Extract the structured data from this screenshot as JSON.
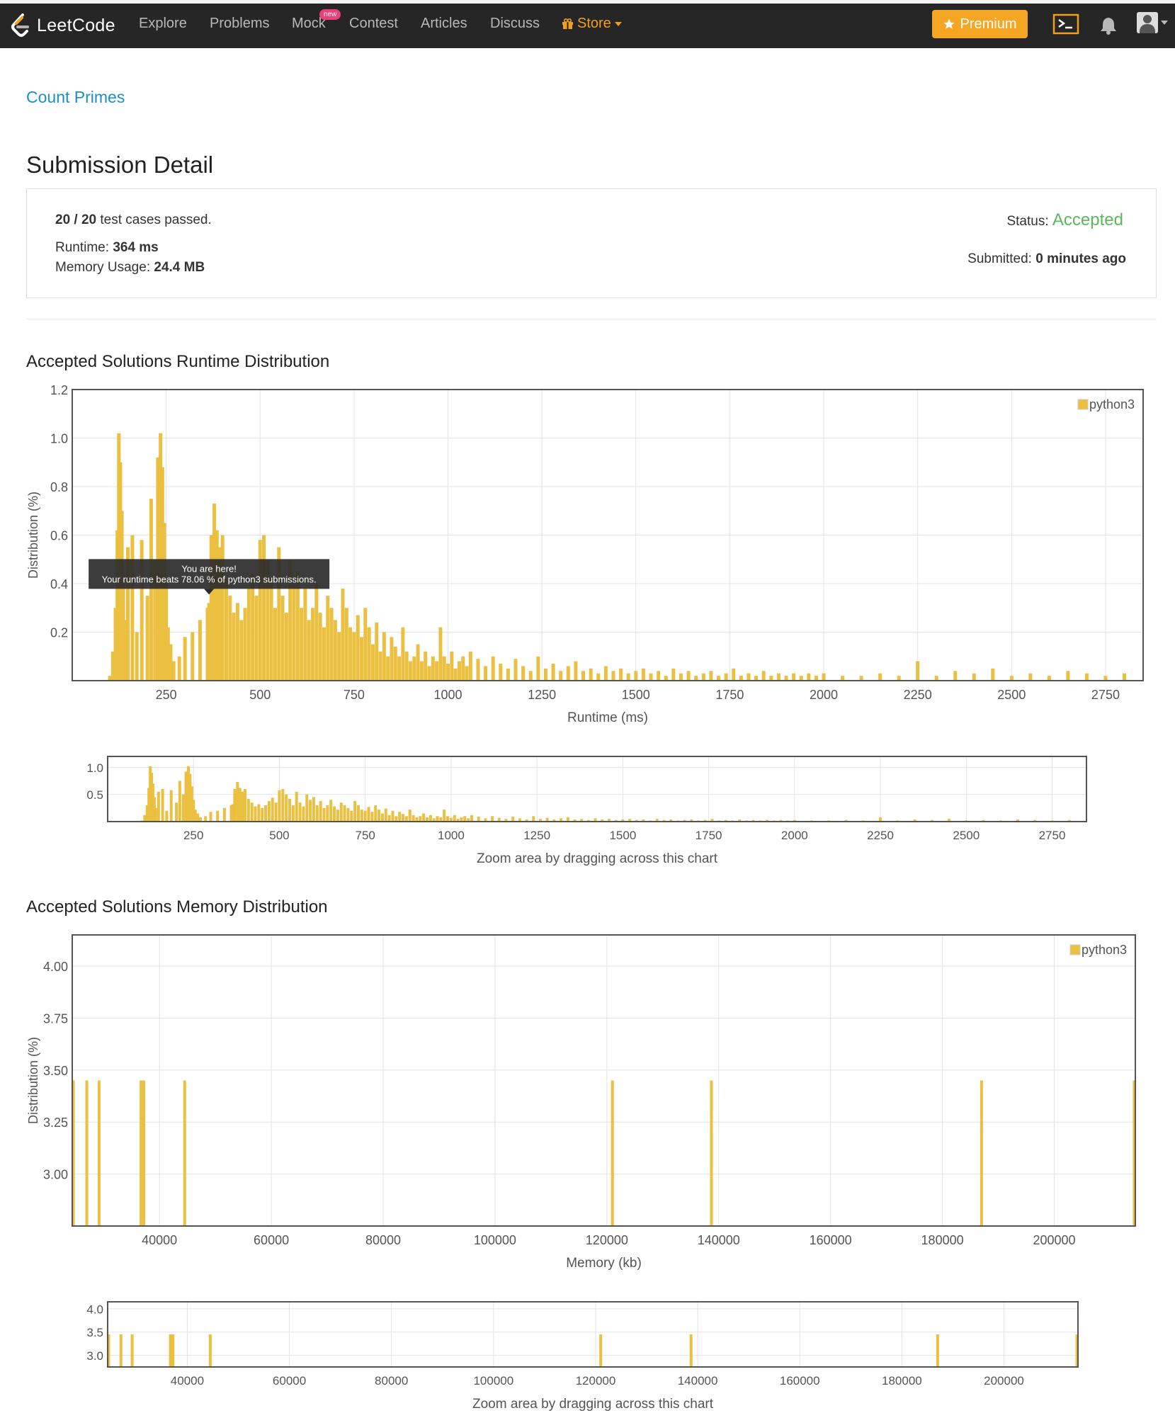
{
  "nav": {
    "brand": "LeetCode",
    "links": [
      "Explore",
      "Problems",
      "Mock",
      "Contest",
      "Articles",
      "Discuss"
    ],
    "new_badge": "new",
    "store": "Store",
    "premium": "Premium"
  },
  "problem": {
    "title": "Count Primes"
  },
  "page_title": "Submission Detail",
  "detail": {
    "passed": "20",
    "total": "20",
    "passed_suffix": "test cases passed.",
    "runtime_label": "Runtime:",
    "runtime_value": "364 ms",
    "memory_label": "Memory Usage:",
    "memory_value": "24.4 MB",
    "status_label": "Status:",
    "status_value": "Accepted",
    "submitted_label": "Submitted:",
    "submitted_value": "0 minutes ago"
  },
  "colors": {
    "accent": "#ebbf3f",
    "status_ok": "#5cb85c",
    "link": "#1a90c6",
    "premium": "#f5a623"
  },
  "tooltip": {
    "line1": "You are here!",
    "line2": "Your runtime beats 78.06 % of python3 submissions."
  },
  "sections": {
    "runtime_title": "Accepted Solutions Runtime Distribution",
    "memory_title": "Accepted Solutions Memory Distribution",
    "zoom_caption": "Zoom area by dragging across this chart"
  },
  "chart_data": [
    {
      "type": "bar",
      "title": "Accepted Solutions Runtime Distribution",
      "xlabel": "Runtime (ms)",
      "ylabel": "Distribution (%)",
      "xlim": [
        0,
        2850
      ],
      "ylim": [
        0,
        1.2
      ],
      "xticks": [
        "250",
        "500",
        "750",
        "1000",
        "1250",
        "1500",
        "1750",
        "2000",
        "2250",
        "2500",
        "2750"
      ],
      "yticks": [
        "0.2",
        "0.4",
        "0.6",
        "0.8",
        "1.0",
        "1.2"
      ],
      "legend": "top-right",
      "grid": true,
      "series": [
        {
          "name": "python3",
          "x": [
            100,
            108,
            115,
            120,
            124,
            128,
            132,
            136,
            140,
            148,
            160,
            172,
            185,
            200,
            210,
            220,
            228,
            235,
            240,
            245,
            250,
            255,
            262,
            270,
            285,
            300,
            320,
            340,
            360,
            364,
            370,
            378,
            385,
            392,
            400,
            410,
            420,
            430,
            440,
            450,
            460,
            470,
            480,
            490,
            500,
            510,
            520,
            530,
            540,
            550,
            560,
            570,
            580,
            590,
            600,
            610,
            620,
            630,
            640,
            650,
            660,
            670,
            680,
            690,
            700,
            710,
            720,
            730,
            740,
            750,
            760,
            770,
            780,
            790,
            800,
            810,
            820,
            830,
            840,
            850,
            860,
            870,
            880,
            890,
            900,
            910,
            920,
            930,
            940,
            950,
            960,
            970,
            980,
            990,
            1000,
            1010,
            1020,
            1030,
            1040,
            1050,
            1060,
            1080,
            1100,
            1120,
            1140,
            1160,
            1180,
            1200,
            1220,
            1240,
            1260,
            1280,
            1300,
            1320,
            1340,
            1360,
            1380,
            1400,
            1420,
            1440,
            1460,
            1480,
            1500,
            1520,
            1540,
            1560,
            1580,
            1600,
            1620,
            1640,
            1660,
            1680,
            1700,
            1720,
            1740,
            1760,
            1780,
            1800,
            1820,
            1840,
            1860,
            1880,
            1900,
            1920,
            1940,
            1960,
            1980,
            2000,
            2050,
            2100,
            2150,
            2200,
            2250,
            2300,
            2350,
            2400,
            2450,
            2500,
            2550,
            2600,
            2650,
            2700,
            2750,
            2800
          ],
          "values": [
            0.02,
            0.12,
            0.3,
            0.62,
            1.02,
            0.9,
            0.7,
            0.45,
            0.25,
            0.55,
            0.6,
            0.2,
            0.58,
            0.35,
            0.75,
            0.5,
            0.92,
            1.02,
            0.88,
            0.65,
            0.4,
            0.22,
            0.15,
            0.08,
            0.1,
            0.18,
            0.2,
            0.25,
            0.3,
            0.32,
            0.6,
            0.73,
            0.62,
            0.55,
            0.6,
            0.42,
            0.35,
            0.28,
            0.32,
            0.25,
            0.3,
            0.38,
            0.44,
            0.35,
            0.58,
            0.6,
            0.5,
            0.42,
            0.3,
            0.55,
            0.35,
            0.28,
            0.5,
            0.4,
            0.45,
            0.3,
            0.38,
            0.25,
            0.3,
            0.4,
            0.28,
            0.22,
            0.35,
            0.3,
            0.25,
            0.2,
            0.38,
            0.3,
            0.22,
            0.2,
            0.27,
            0.18,
            0.3,
            0.22,
            0.15,
            0.24,
            0.12,
            0.2,
            0.1,
            0.18,
            0.14,
            0.1,
            0.22,
            0.12,
            0.08,
            0.1,
            0.15,
            0.08,
            0.12,
            0.06,
            0.1,
            0.08,
            0.22,
            0.1,
            0.07,
            0.12,
            0.05,
            0.08,
            0.1,
            0.06,
            0.12,
            0.09,
            0.06,
            0.1,
            0.07,
            0.05,
            0.09,
            0.06,
            0.04,
            0.1,
            0.05,
            0.07,
            0.04,
            0.06,
            0.08,
            0.04,
            0.05,
            0.03,
            0.06,
            0.04,
            0.05,
            0.03,
            0.04,
            0.05,
            0.03,
            0.04,
            0.02,
            0.05,
            0.03,
            0.04,
            0.02,
            0.03,
            0.04,
            0.02,
            0.03,
            0.05,
            0.02,
            0.03,
            0.02,
            0.04,
            0.02,
            0.03,
            0.02,
            0.03,
            0.02,
            0.03,
            0.02,
            0.03,
            0.02,
            0.02,
            0.03,
            0.02,
            0.08,
            0.02,
            0.04,
            0.03,
            0.05,
            0.02,
            0.03,
            0.02,
            0.04,
            0.03,
            0.02,
            0.03
          ]
        }
      ]
    },
    {
      "type": "bar",
      "title": "Accepted Solutions Memory Distribution",
      "xlabel": "Memory (kb)",
      "ylabel": "Distribution (%)",
      "xlim": [
        24400,
        214500
      ],
      "ylim": [
        2.75,
        4.15
      ],
      "xticks": [
        "40000",
        "60000",
        "80000",
        "100000",
        "120000",
        "140000",
        "160000",
        "180000",
        "200000"
      ],
      "yticks": [
        "3.00",
        "3.25",
        "3.50",
        "3.75",
        "4.00"
      ],
      "legend": "top-right",
      "grid": true,
      "series": [
        {
          "name": "python3",
          "x": [
            24600,
            27000,
            29200,
            36700,
            37200,
            44500,
            121000,
            138700,
            187000,
            214300
          ],
          "values": [
            3.45,
            3.45,
            3.45,
            3.45,
            3.45,
            3.45,
            3.45,
            3.45,
            3.45,
            3.45
          ]
        }
      ]
    }
  ]
}
